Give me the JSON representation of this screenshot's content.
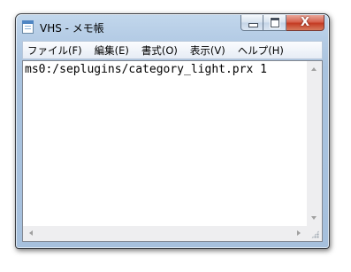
{
  "window": {
    "title": "VHS - メモ帳"
  },
  "caption_buttons": {
    "minimize_icon": "minimize-icon",
    "maximize_icon": "maximize-icon",
    "close_icon": "close-icon",
    "close_glyph": "X"
  },
  "menu": {
    "items": [
      {
        "label": "ファイル(F)"
      },
      {
        "label": "編集(E)"
      },
      {
        "label": "書式(O)"
      },
      {
        "label": "表示(V)"
      },
      {
        "label": "ヘルプ(H)"
      }
    ]
  },
  "editor": {
    "content": "ms0:/seplugins/category_light.prx 1"
  },
  "colors": {
    "titlebar": "#b6cde6",
    "close_button": "#c43b23",
    "menubar": "#e6ecf5"
  }
}
